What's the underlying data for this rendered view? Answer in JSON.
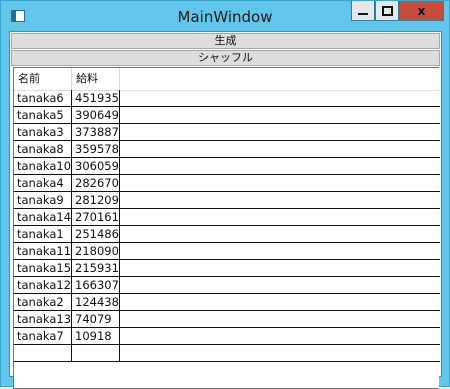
{
  "window": {
    "title": "MainWindow",
    "controls": {
      "minimize": "minimize",
      "maximize": "maximize",
      "close": "x"
    }
  },
  "toolbar": {
    "generate_label": "生成",
    "shuffle_label": "シャッフル"
  },
  "grid": {
    "columns": [
      "名前",
      "給料"
    ],
    "rows": [
      {
        "name": "tanaka6",
        "salary": "451935"
      },
      {
        "name": "tanaka5",
        "salary": "390649"
      },
      {
        "name": "tanaka3",
        "salary": "373887"
      },
      {
        "name": "tanaka8",
        "salary": "359578"
      },
      {
        "name": "tanaka10",
        "salary": "306059"
      },
      {
        "name": "tanaka4",
        "salary": "282670"
      },
      {
        "name": "tanaka9",
        "salary": "281209"
      },
      {
        "name": "tanaka14",
        "salary": "270161"
      },
      {
        "name": "tanaka1",
        "salary": "251486"
      },
      {
        "name": "tanaka11",
        "salary": "218090"
      },
      {
        "name": "tanaka15",
        "salary": "215931"
      },
      {
        "name": "tanaka12",
        "salary": "166307"
      },
      {
        "name": "tanaka2",
        "salary": "124438"
      },
      {
        "name": "tanaka13",
        "salary": "74079"
      },
      {
        "name": "tanaka7",
        "salary": "10918"
      },
      {
        "name": "",
        "salary": ""
      }
    ]
  }
}
